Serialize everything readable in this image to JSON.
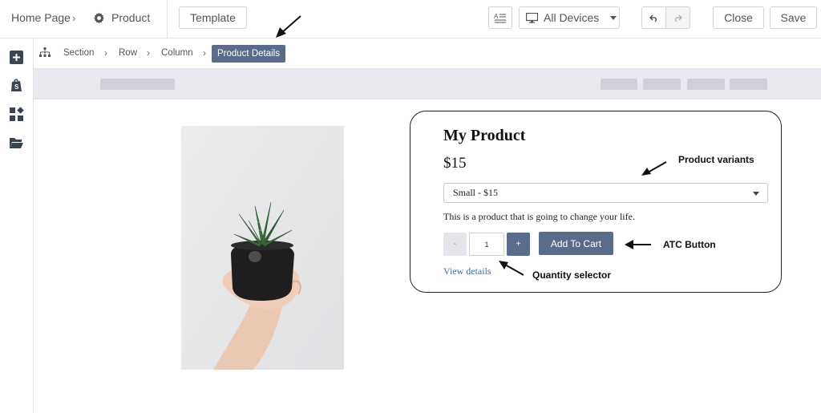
{
  "header": {
    "home_label": "Home Page",
    "page_label": "Product",
    "template_label": "Template",
    "device_label": "All Devices",
    "close_label": "Close",
    "save_label": "Save"
  },
  "breadcrumb": {
    "items": [
      "Section",
      "Row",
      "Column"
    ],
    "active": "Product Details"
  },
  "sidebar": {
    "items": [
      "add-element-icon",
      "shopify-icon",
      "widgets-icon",
      "folder-icon"
    ]
  },
  "product": {
    "title": "My Product",
    "price": "$15",
    "variant_selected": "Small - $15",
    "description": "This is a product that is going to change your life.",
    "quantity_minus": "-",
    "quantity_value": "1",
    "quantity_plus": "+",
    "add_to_cart_label": "Add To Cart",
    "view_details_label": "View details"
  },
  "annotations": {
    "variants": "Product variants",
    "atc": "ATC Button",
    "quantity": "Quantity selector"
  },
  "colors": {
    "accent": "#5b6b8c",
    "link": "#3d6aa8",
    "strip": "#e9eaef"
  }
}
